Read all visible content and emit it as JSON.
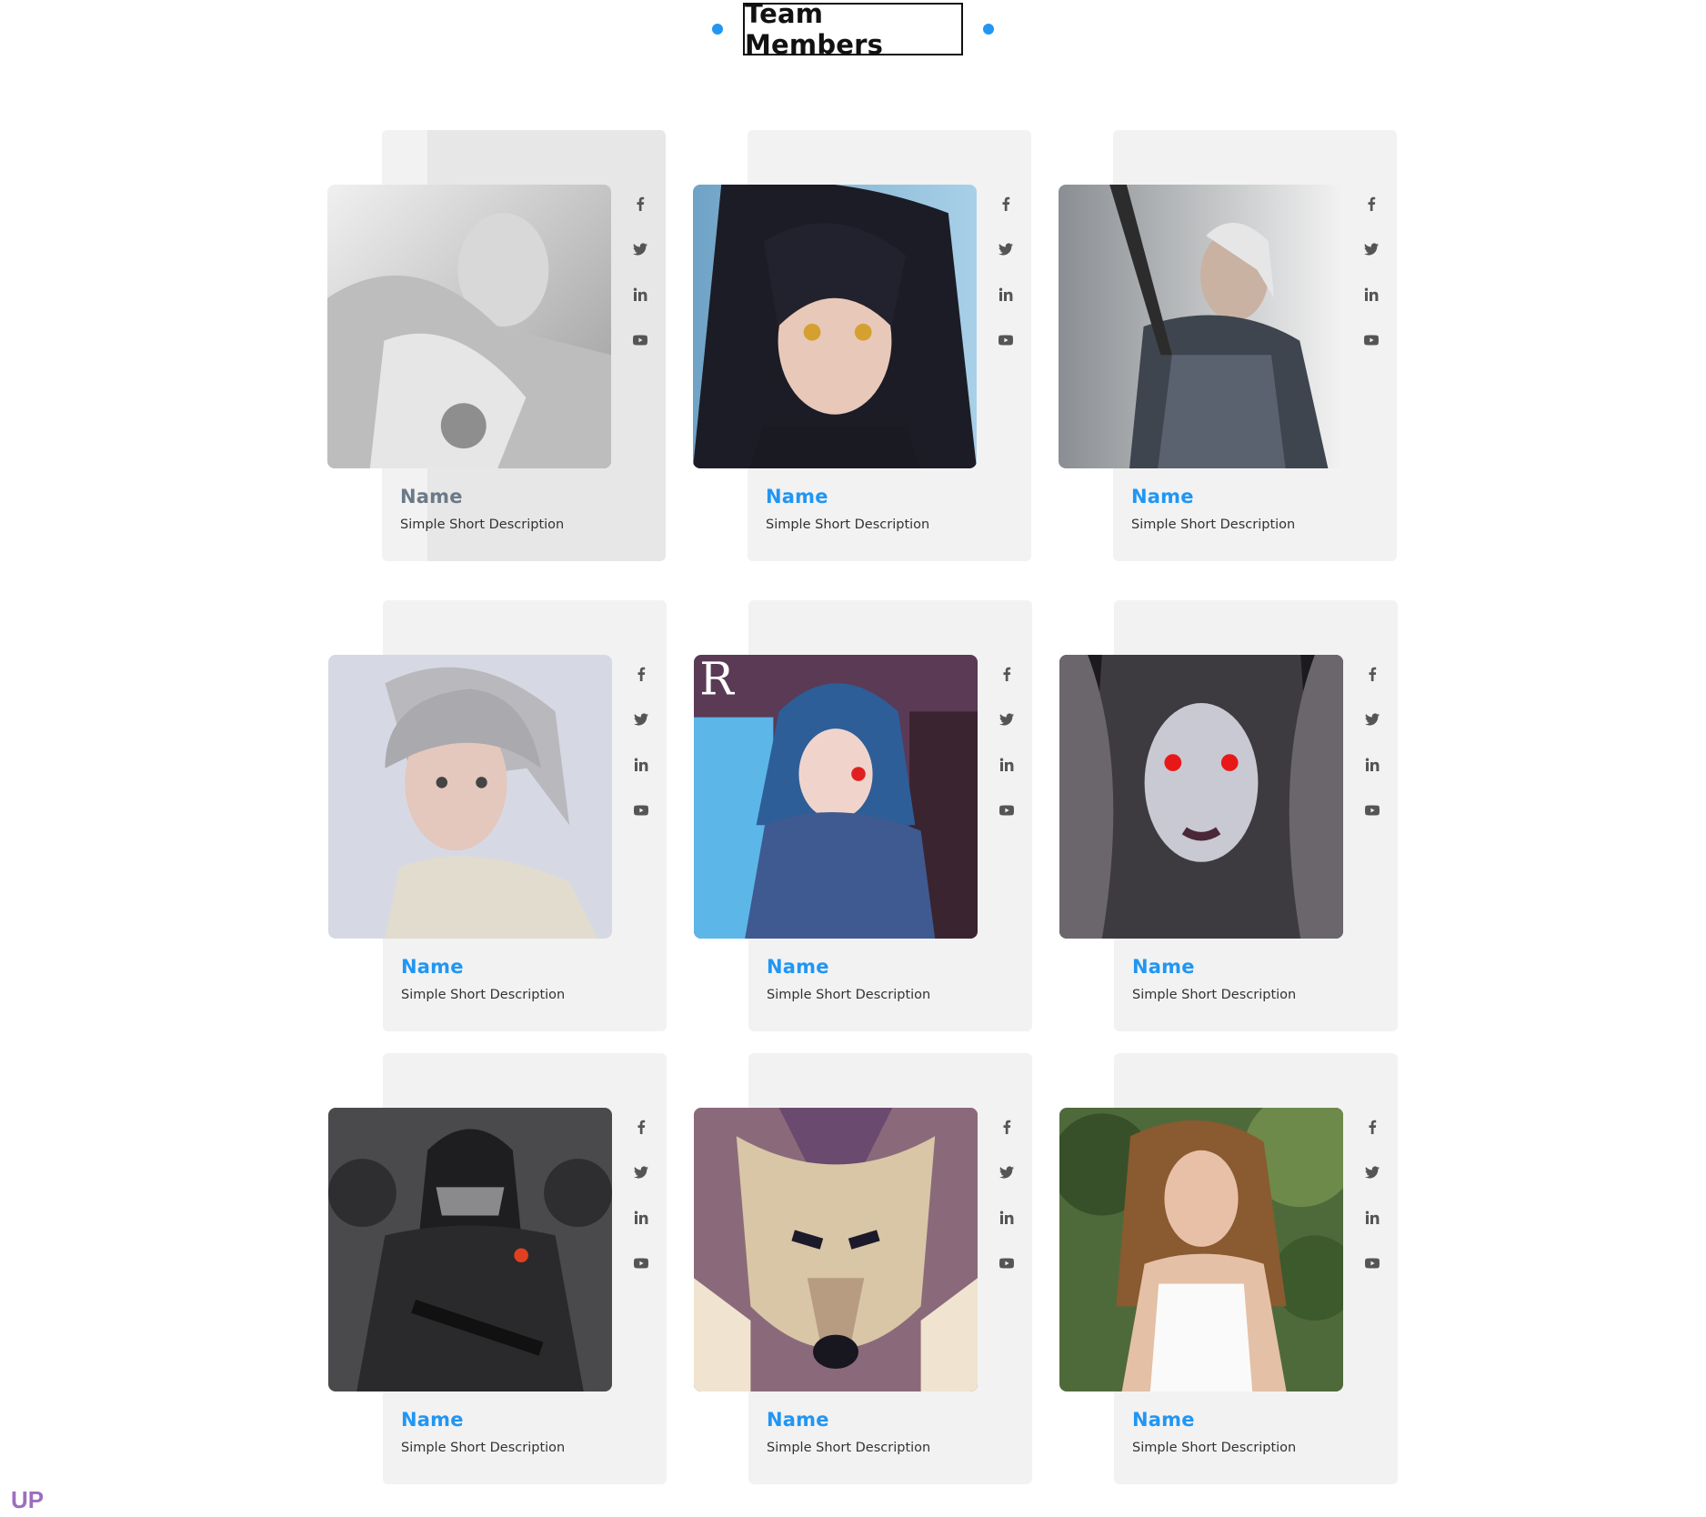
{
  "section": {
    "title": "Team Members",
    "accent_color": "#2196f3"
  },
  "members": [
    {
      "name": "Name",
      "description": "Simple Short Description",
      "photo": "anime-girl-sketch-grayscale",
      "state": "hover"
    },
    {
      "name": "Name",
      "description": "Simple Short Description",
      "photo": "anime-girl-dark-hair"
    },
    {
      "name": "Name",
      "description": "Simple Short Description",
      "photo": "witcher-geralt"
    },
    {
      "name": "Name",
      "description": "Simple Short Description",
      "photo": "ciri-portrait"
    },
    {
      "name": "Name",
      "description": "Simple Short Description",
      "photo": "hooded-anime-boy"
    },
    {
      "name": "Name",
      "description": "Simple Short Description",
      "photo": "pale-dark-elf"
    },
    {
      "name": "Name",
      "description": "Simple Short Description",
      "photo": "armored-soldier"
    },
    {
      "name": "Name",
      "description": "Simple Short Description",
      "photo": "wolf-face"
    },
    {
      "name": "Name",
      "description": "Simple Short Description",
      "photo": "woman-outdoors"
    }
  ],
  "social_icons": [
    "facebook-icon",
    "twitter-icon",
    "linkedin-icon",
    "youtube-icon"
  ],
  "footer": {
    "up_label": "UP",
    "up_color": "#9b6fbf"
  }
}
